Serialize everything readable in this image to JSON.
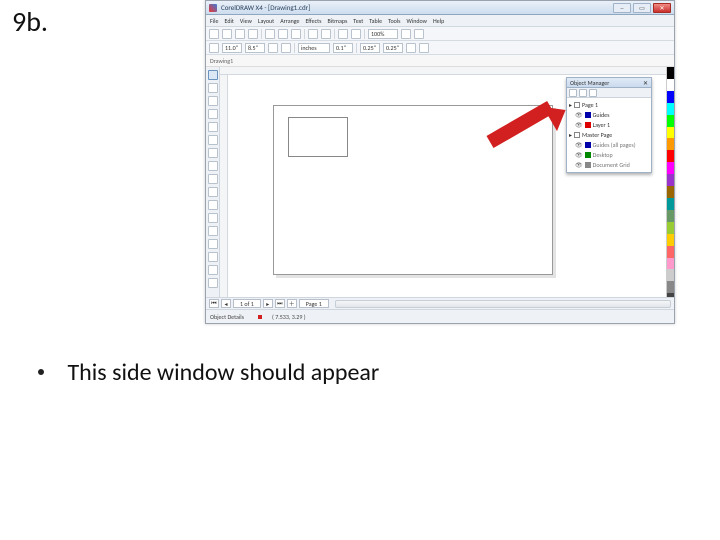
{
  "slide": {
    "step_label": "9b.",
    "bullet_text": "This side window should appear"
  },
  "app": {
    "title": "CorelDRAW X4 - [Drawing1.cdr]",
    "menus": [
      "File",
      "Edit",
      "View",
      "Layout",
      "Arrange",
      "Effects",
      "Bitmaps",
      "Text",
      "Table",
      "Tools",
      "Window",
      "Help"
    ],
    "doc_name": "Drawing1",
    "property_bar": {
      "page_w": "11.0\"",
      "page_h": "8.5\"",
      "units": "inches",
      "nudge": "0.1\"",
      "dup_x": "0.25\"",
      "dup_y": "0.25\""
    },
    "pager": {
      "page_indicator": "1 of 1",
      "page_tab": "Page 1"
    },
    "status": {
      "hint": "Object Details",
      "coords": "( 7.533, 3.29 )"
    },
    "panel": {
      "title": "Object Manager",
      "tree": {
        "page": "Page 1",
        "guides": "Guides",
        "layer": "Layer 1",
        "master": "Master Page",
        "m_guides": "Guides (all pages)",
        "desktop": "Desktop",
        "docgrid": "Document Grid"
      }
    },
    "palette_colors": [
      "#000",
      "#fff",
      "#00f",
      "#0ff",
      "#0f0",
      "#ff0",
      "#f90",
      "#f00",
      "#f0f",
      "#93c",
      "#960",
      "#099",
      "#696",
      "#9c3",
      "#fc0",
      "#f66",
      "#f9c",
      "#ccc",
      "#888",
      "#444"
    ]
  }
}
